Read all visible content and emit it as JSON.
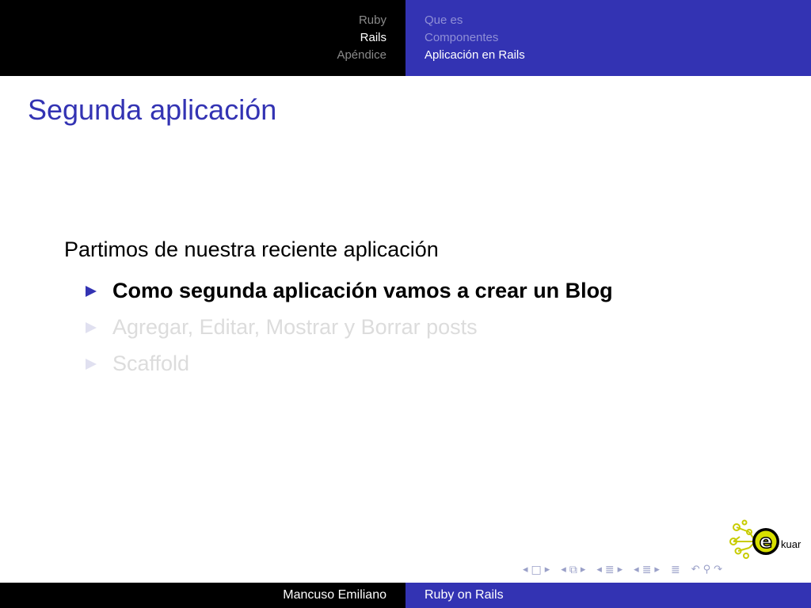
{
  "header": {
    "sections": [
      {
        "label": "Ruby",
        "active": false
      },
      {
        "label": "Rails",
        "active": true
      },
      {
        "label": "Apéndice",
        "active": false
      }
    ],
    "subsections": [
      {
        "label": "Que es",
        "active": false
      },
      {
        "label": "Componentes",
        "active": false
      },
      {
        "label": "Aplicación en Rails",
        "active": true
      }
    ]
  },
  "frame": {
    "title": "Segunda aplicación",
    "intro": "Partimos de nuestra reciente aplicación",
    "bullets": [
      {
        "text": "Como segunda aplicación vamos a crear un Blog",
        "state": "highlighted"
      },
      {
        "text": "Agregar, Editar, Mostrar y Borrar posts",
        "state": "dimmed"
      },
      {
        "text": "Scaffold",
        "state": "dimmed"
      }
    ]
  },
  "logo": {
    "letter": "e",
    "text": "kuar"
  },
  "footer": {
    "author": "Mancuso Emiliano",
    "title": "Ruby on Rails"
  },
  "colors": {
    "accent": "#3333b3",
    "header_dark": "#000000",
    "logo_yellow": "#d8e000",
    "dimmed_text": "#dcdcdc"
  },
  "nav_icons": [
    "frame-prev-icon",
    "frame-icon",
    "frame-next-icon",
    "subsection-prev-icon",
    "subsection-icon",
    "subsection-next-icon",
    "section-prev-icon",
    "section-icon",
    "section-next-icon",
    "subsection-prev-icon",
    "subsection-icon",
    "subsection-next-icon",
    "document-icon",
    "undo-icon",
    "search-icon",
    "redo-icon"
  ]
}
